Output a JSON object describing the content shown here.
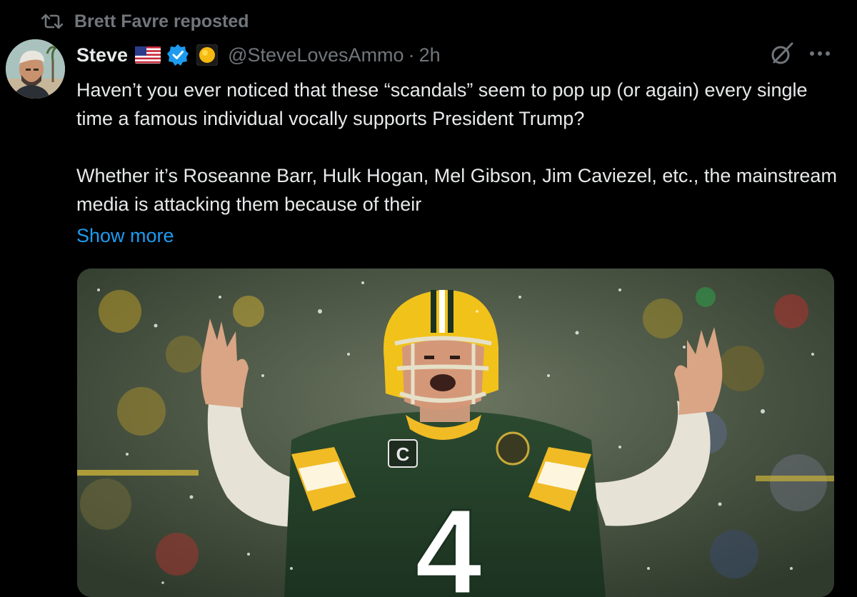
{
  "repost": {
    "icon": "repost-icon",
    "text": "Brett Favre reposted"
  },
  "tweet": {
    "author_name": "Steve",
    "flag_icon": "us-flag-icon",
    "verified_icon": "verified-badge-icon",
    "affiliate_icon": "yellow-circle-icon",
    "handle": "@SteveLovesAmmo",
    "separator": "·",
    "time": "2h",
    "text_paragraphs": [
      "Haven’t you ever noticed that these “scandals” seem to pop up (or again) every single time a famous individual vocally supports President Trump?",
      "Whether it’s Roseanne Barr, Hulk Hogan, Mel Gibson, Jim Caviezel, etc., the mainstream media is attacking them because of their"
    ],
    "show_more": "Show more",
    "grok_icon": "grok-icon",
    "more_icon": "more-options-icon"
  },
  "media": {
    "jersey_number": "4",
    "captain_patch": "C"
  },
  "colors": {
    "background": "#000000",
    "text_primary": "#e7e9ea",
    "text_secondary": "#71767b",
    "link": "#1d9bf0",
    "verified": "#1d9bf0"
  }
}
